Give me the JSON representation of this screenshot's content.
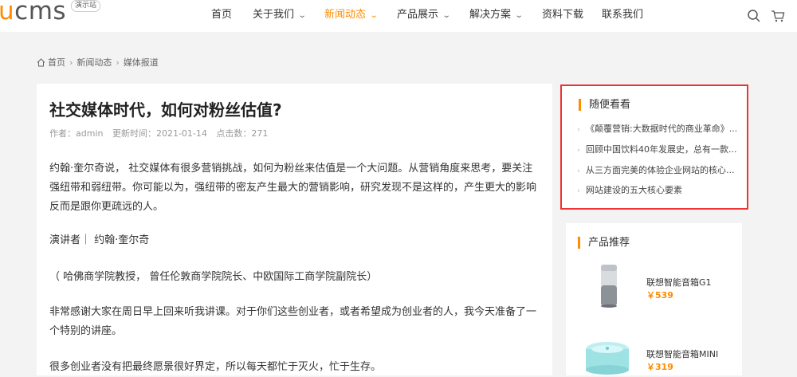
{
  "header": {
    "logo_main": "ucms",
    "demo_badge": "演示站",
    "nav": [
      {
        "label": "首页",
        "dropdown": false,
        "active": false
      },
      {
        "label": "关于我们",
        "dropdown": true,
        "active": false
      },
      {
        "label": "新闻动态",
        "dropdown": true,
        "active": true
      },
      {
        "label": "产品展示",
        "dropdown": true,
        "active": false
      },
      {
        "label": "解决方案",
        "dropdown": true,
        "active": false
      },
      {
        "label": "资料下载",
        "dropdown": false,
        "active": false
      },
      {
        "label": "联系我们",
        "dropdown": false,
        "active": false
      }
    ],
    "icons": [
      "search-icon",
      "cart-icon"
    ]
  },
  "breadcrumb": [
    "首页",
    "新闻动态",
    "媒体报道"
  ],
  "article": {
    "title": "社交媒体时代，如何对粉丝估值?",
    "author": "作者：admin",
    "updated": "更新时间：2021-01-14",
    "views": "点击数：271",
    "paragraphs": [
      "约翰·奎尔奇说， 社交媒体有很多营销挑战，如何为粉丝来估值是一个大问题。从营销角度来思考，要关注强纽带和弱纽带。你可能以为，强纽带的密友产生最大的营销影响，研究发现不是这样的，产生更大的影响反而是跟你更疏远的人。",
      "演讲者｜ 约翰·奎尔奇",
      "（ 哈佛商学院教授， 曾任伦敦商学院院长、中欧国际工商学院副院长）",
      "非常感谢大家在周日早上回来听我讲课。对于你们这些创业者，或者希望成为创业者的人，我今天准备了一个特别的讲座。",
      "很多创业者没有把最终愿景很好界定，所以每天都忙于灭火，忙于生存。"
    ]
  },
  "sidebar": {
    "random": {
      "title": "随便看看",
      "items": [
        "《颠覆营销:大数据时代的商业革命》...",
        "回顾中国饮料40年发展史，总有一款...",
        "从三方面完美的体验企业网站的核心...",
        "网站建设的五大核心要素"
      ]
    },
    "recommend": {
      "title": "产品推荐",
      "products": [
        {
          "name": "联想智能音箱G1",
          "price": "￥539"
        },
        {
          "name": "联想智能音箱MINI",
          "price": "￥319"
        }
      ]
    }
  },
  "colors": {
    "accent": "#ff8c00",
    "highlight_border": "#e33"
  }
}
